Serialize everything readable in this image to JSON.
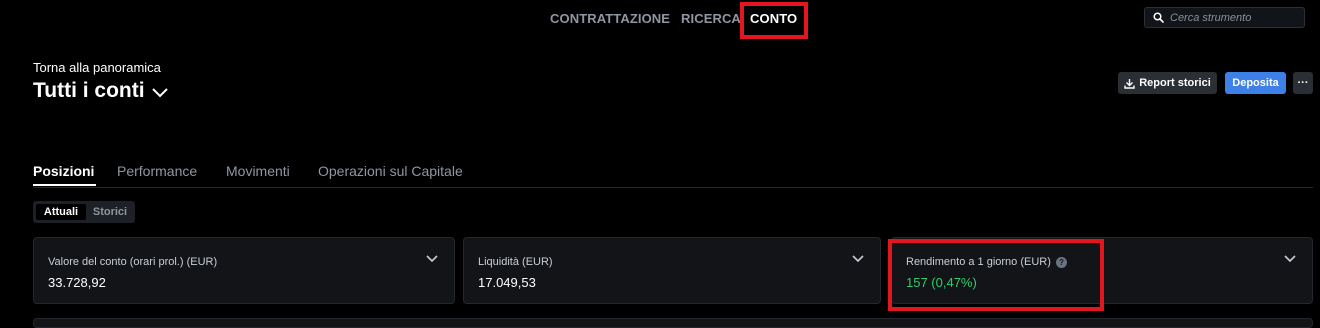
{
  "nav": {
    "items": [
      {
        "label": "CONTRATTAZIONE",
        "active": false
      },
      {
        "label": "RICERCA",
        "active": false
      },
      {
        "label": "CONTO",
        "active": true
      }
    ],
    "search": {
      "placeholder": "Cerca strumento",
      "value": "",
      "icon": "search-icon"
    }
  },
  "header": {
    "back_label": "Torna alla panoramica",
    "title": "Tutti i conti",
    "title_icon": "chevron-down-icon"
  },
  "actions": {
    "report_label": "Report storici",
    "report_icon": "download-icon",
    "deposit_label": "Deposita",
    "more_label": "···"
  },
  "tabs": [
    {
      "label": "Posizioni",
      "active": true
    },
    {
      "label": "Performance",
      "active": false
    },
    {
      "label": "Movimenti",
      "active": false
    },
    {
      "label": "Operazioni sul Capitale",
      "active": false
    }
  ],
  "toggle": {
    "options": [
      {
        "label": "Attuali",
        "selected": true
      },
      {
        "label": "Storici",
        "selected": false
      }
    ]
  },
  "cards": [
    {
      "label": "Valore del conto (orari prol.) (EUR)",
      "value": "33.728,92"
    },
    {
      "label": "Liquidità (EUR)",
      "value": "17.049,53"
    },
    {
      "label": "Rendimento a 1 giorno (EUR)",
      "value": "157 (0,47%)",
      "help_icon": "help-icon",
      "value_color": "#2ecc6b"
    }
  ],
  "colors": {
    "accent": "#3f7fe8",
    "positive": "#2ecc6b",
    "highlight": "#e3161f"
  }
}
